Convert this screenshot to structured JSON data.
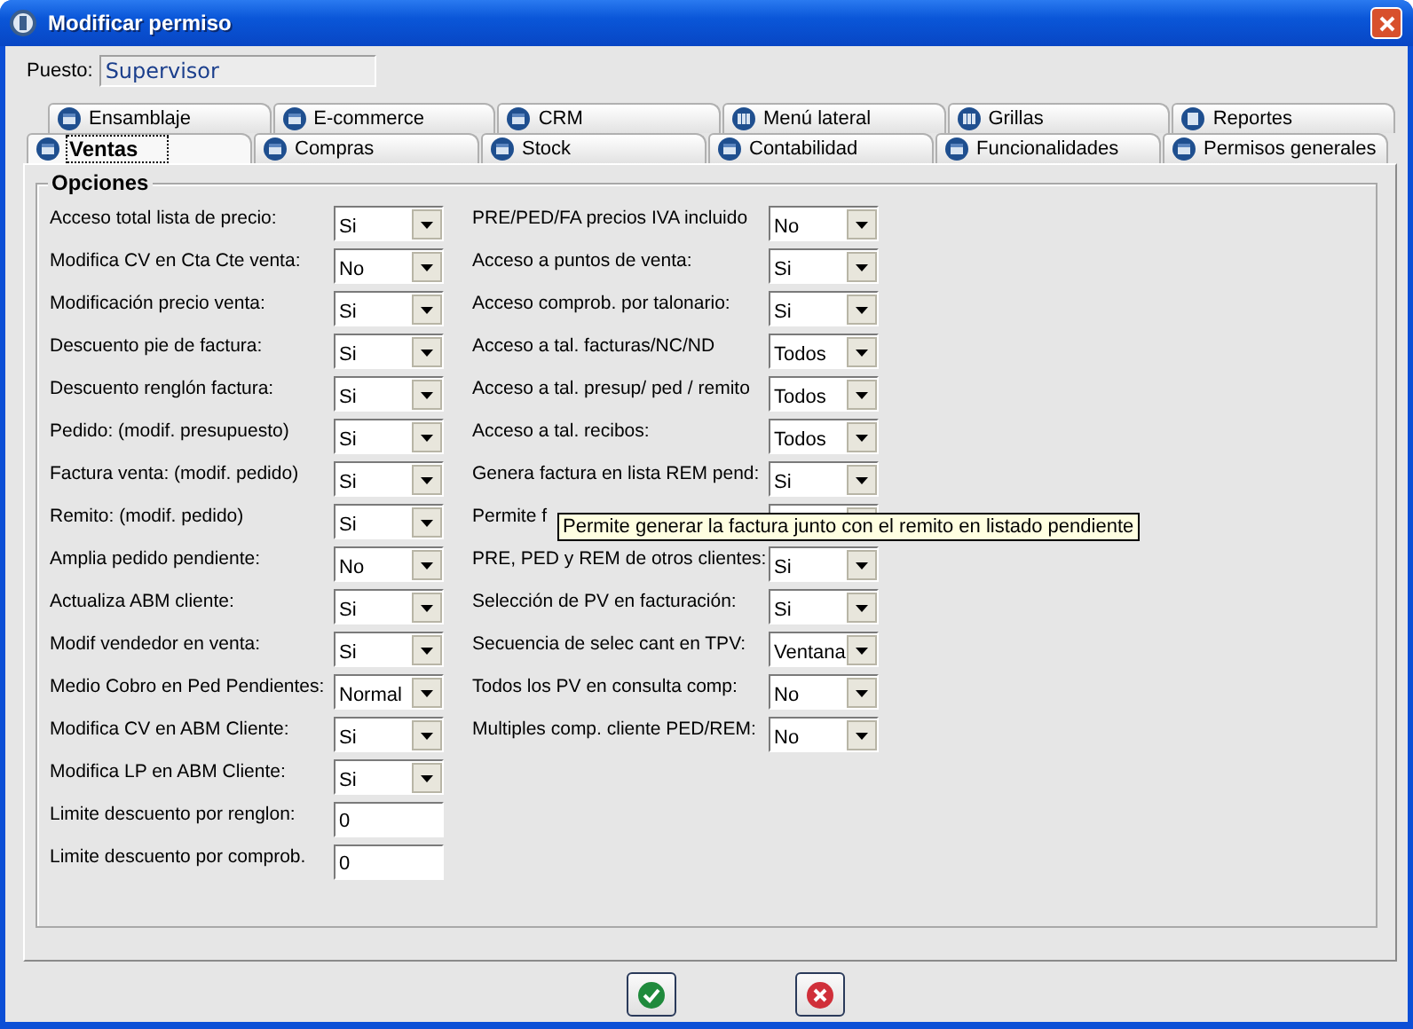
{
  "window": {
    "title": "Modificar permiso"
  },
  "position": {
    "label": "Puesto:",
    "value": "Supervisor"
  },
  "tab_rows": [
    [
      {
        "label": "Ensamblaje",
        "kind": "form",
        "selected": false
      },
      {
        "label": "E-commerce",
        "kind": "form",
        "selected": false
      },
      {
        "label": "CRM",
        "kind": "form",
        "selected": false
      },
      {
        "label": "Menú lateral",
        "kind": "columns",
        "selected": false
      },
      {
        "label": "Grillas",
        "kind": "columns",
        "selected": false
      },
      {
        "label": "Reportes",
        "kind": "report",
        "selected": false
      }
    ],
    [
      {
        "label": "Ventas",
        "kind": "form",
        "selected": true
      },
      {
        "label": "Compras",
        "kind": "form",
        "selected": false
      },
      {
        "label": "Stock",
        "kind": "form",
        "selected": false
      },
      {
        "label": "Contabilidad",
        "kind": "form",
        "selected": false
      },
      {
        "label": "Funcionalidades",
        "kind": "form",
        "selected": false
      },
      {
        "label": "Permisos generales",
        "kind": "form",
        "selected": false
      }
    ]
  ],
  "options": {
    "title": "Opciones",
    "columns": [
      [
        {
          "label": "Acceso total lista de precio:",
          "kind": "combo",
          "value": "Si"
        },
        {
          "label": "Modifica CV en Cta Cte venta:",
          "kind": "combo",
          "value": "No"
        },
        {
          "label": "Modificación precio venta:",
          "kind": "combo",
          "value": "Si"
        },
        {
          "label": "Descuento pie de factura:",
          "kind": "combo",
          "value": "Si"
        },
        {
          "label": "Descuento renglón factura:",
          "kind": "combo",
          "value": "Si"
        },
        {
          "label": "Pedido: (modif. presupuesto)",
          "kind": "combo",
          "value": "Si"
        },
        {
          "label": "Factura venta: (modif. pedido)",
          "kind": "combo",
          "value": "Si"
        },
        {
          "label": "Remito: (modif. pedido)",
          "kind": "combo",
          "value": "Si"
        },
        {
          "label": "Amplia pedido pendiente:",
          "kind": "combo",
          "value": "No"
        },
        {
          "label": "Actualiza ABM cliente:",
          "kind": "combo",
          "value": "Si"
        },
        {
          "label": "Modif vendedor en venta:",
          "kind": "combo",
          "value": "Si"
        },
        {
          "label": "Medio Cobro en Ped Pendientes:",
          "kind": "combo",
          "value": "Normal"
        },
        {
          "label": "Modifica CV en ABM Cliente:",
          "kind": "combo",
          "value": "Si"
        },
        {
          "label": "Modifica LP en ABM Cliente:",
          "kind": "combo",
          "value": "Si"
        },
        {
          "label": "Limite descuento por renglon:",
          "kind": "text",
          "value": "0"
        },
        {
          "label": "Limite descuento por comprob.",
          "kind": "text",
          "value": "0"
        }
      ],
      [
        {
          "label": "PRE/PED/FA precios IVA incluido",
          "kind": "combo",
          "value": "No"
        },
        {
          "label": "Acceso a puntos de venta:",
          "kind": "combo",
          "value": "Si"
        },
        {
          "label": "Acceso comprob. por talonario:",
          "kind": "combo",
          "value": "Si"
        },
        {
          "label": "Acceso a tal. facturas/NC/ND",
          "kind": "combo",
          "value": "Todos"
        },
        {
          "label": "Acceso a tal. presup/ ped / remito",
          "kind": "combo",
          "value": "Todos"
        },
        {
          "label": "Acceso a tal. recibos:",
          "kind": "combo",
          "value": "Todos"
        },
        {
          "label": "Genera factura en lista REM pend:",
          "kind": "combo",
          "value": "Si"
        },
        {
          "label": "Permite f",
          "kind": "combo"
        },
        {
          "label": "PRE, PED y REM de otros clientes:",
          "kind": "combo",
          "value": "Si"
        },
        {
          "label": "Selección de PV en facturación:",
          "kind": "combo",
          "value": "Si"
        },
        {
          "label": "Secuencia de selec cant en TPV:",
          "kind": "combo",
          "value": "Ventana"
        },
        {
          "label": "Todos los PV en consulta comp:",
          "kind": "combo",
          "value": "No"
        },
        {
          "label": "Multiples comp. cliente PED/REM:",
          "kind": "combo",
          "value": "No"
        }
      ]
    ]
  },
  "tooltip": "Permite generar la factura junto con el remito en listado pendiente",
  "buttons": [
    {
      "kind": "confirm"
    },
    {
      "kind": "cancel"
    }
  ]
}
